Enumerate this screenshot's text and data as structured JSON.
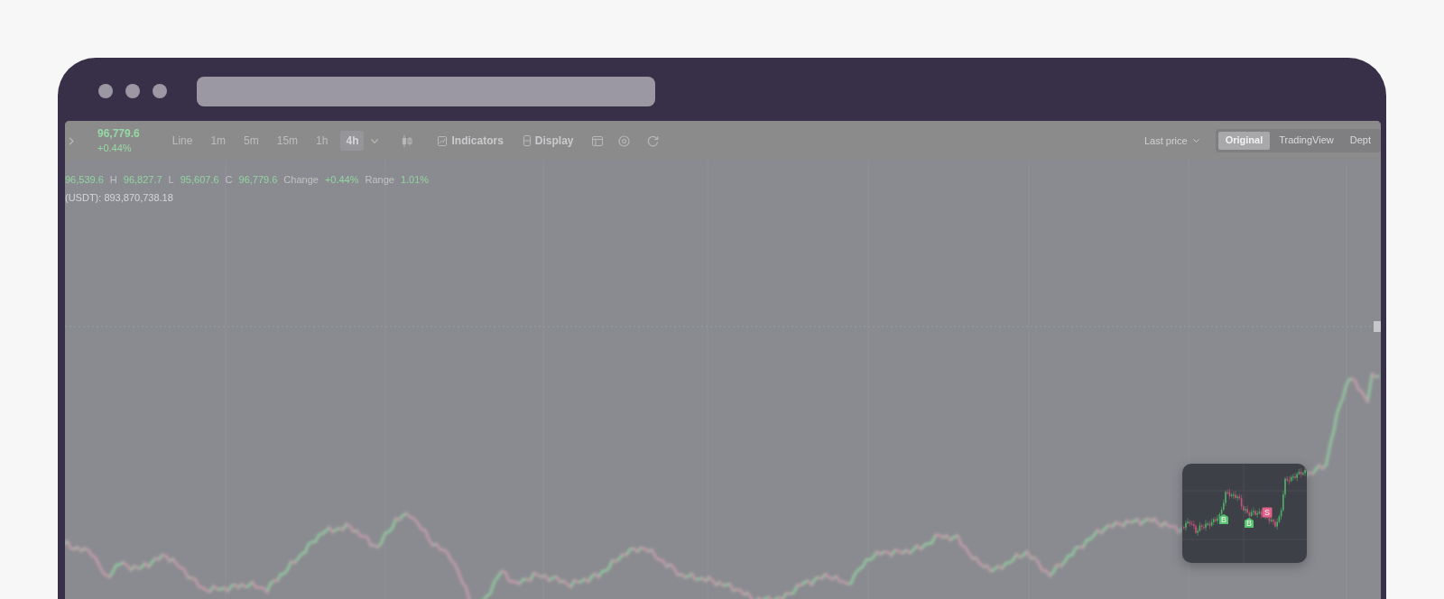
{
  "toolbar": {
    "last_price": "96,779.6",
    "change": "+0.44%",
    "intervals": [
      {
        "label": "Line",
        "selected": false
      },
      {
        "label": "1m",
        "selected": false
      },
      {
        "label": "5m",
        "selected": false
      },
      {
        "label": "15m",
        "selected": false
      },
      {
        "label": "1h",
        "selected": false
      },
      {
        "label": "4h",
        "selected": true
      }
    ],
    "indicators": "Indicators",
    "display": "Display",
    "price_source": "Last price",
    "views": [
      {
        "label": "Original",
        "selected": true
      },
      {
        "label": "TradingView",
        "selected": false
      },
      {
        "label": "Dept",
        "selected": false
      }
    ]
  },
  "legend": {
    "items": [
      {
        "value": "96,539.6"
      },
      {
        "label": "H",
        "value": "96,827.7"
      },
      {
        "label": "L",
        "value": "95,607.6"
      },
      {
        "label": "C",
        "value": "96,779.6"
      },
      {
        "label": "Change",
        "value": "+0.44%"
      },
      {
        "label": "Range",
        "value": "1.01%"
      }
    ],
    "volume": "(USDT): 893,870,738.18"
  },
  "preview": {
    "markers": [
      {
        "label": "B",
        "kind": "buy"
      },
      {
        "label": "B",
        "kind": "buy"
      },
      {
        "label": "S",
        "kind": "sell"
      }
    ]
  }
}
